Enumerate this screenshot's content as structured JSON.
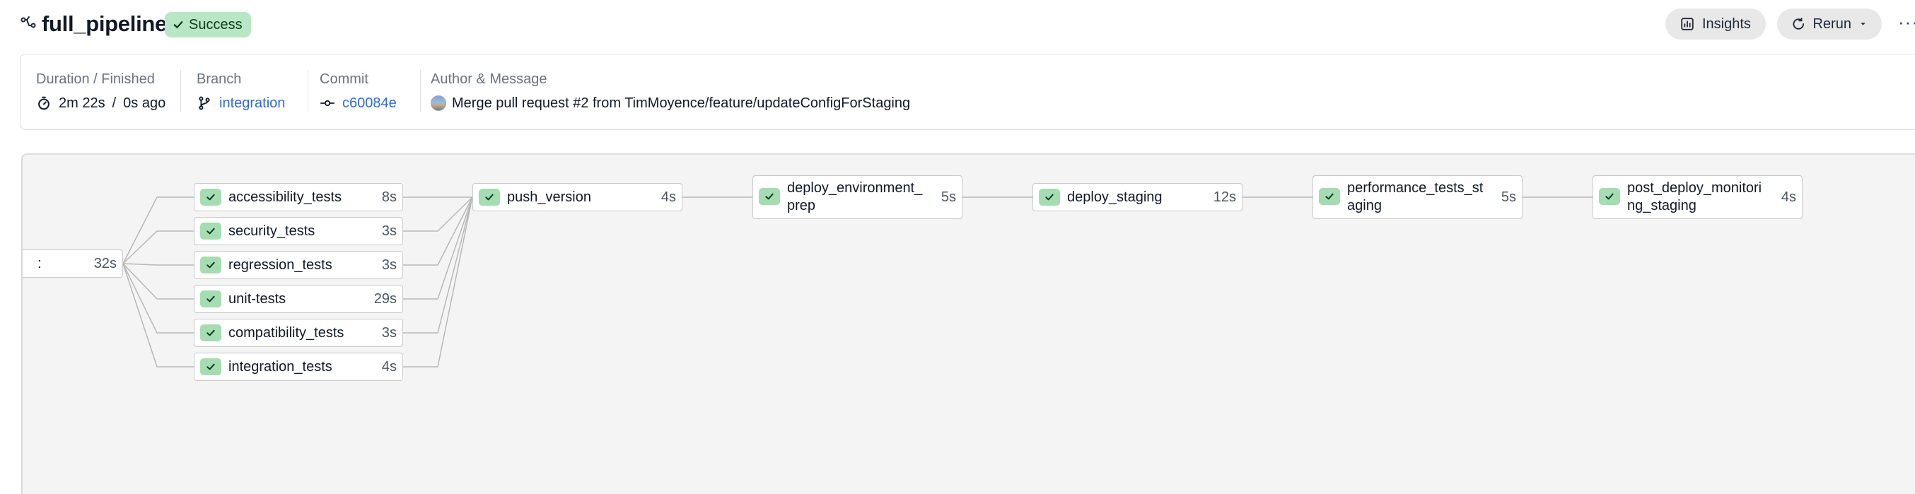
{
  "pipeline": {
    "title": "full_pipeline",
    "status": "Success",
    "status_color": "#b9e6c4",
    "icon": "pipeline-icon"
  },
  "header_actions": {
    "insights_label": "Insights",
    "rerun_label": "Rerun",
    "more_label": "···"
  },
  "summary": {
    "duration_label": "Duration / Finished",
    "duration": "2m 22s",
    "separator": "/",
    "finished": "0s ago",
    "branch_label": "Branch",
    "branch": "integration",
    "commit_label": "Commit",
    "commit": "c60084e",
    "author_label": "Author & Message",
    "message": "Merge pull request #2 from TimMoyence/feature/updateConfigForStaging"
  },
  "graph": {
    "root_stage": {
      "name": ":",
      "duration": "32s"
    },
    "test_stages": [
      {
        "name": "accessibility_tests",
        "duration": "8s"
      },
      {
        "name": "security_tests",
        "duration": "3s"
      },
      {
        "name": "regression_tests",
        "duration": "3s"
      },
      {
        "name": "unit-tests",
        "duration": "29s"
      },
      {
        "name": "compatibility_tests",
        "duration": "3s"
      },
      {
        "name": "integration_tests",
        "duration": "4s"
      }
    ],
    "deploy_stages": [
      {
        "name": "push_version",
        "duration": "4s"
      },
      {
        "name": "deploy_environment_prep",
        "duration": "5s"
      },
      {
        "name": "deploy_staging",
        "duration": "12s"
      },
      {
        "name": "performance_tests_staging",
        "duration": "5s"
      },
      {
        "name": "post_deploy_monitoring_staging",
        "duration": "4s"
      }
    ],
    "edge_color": "#b8b8b8",
    "success_color": "#a6dcb2"
  }
}
